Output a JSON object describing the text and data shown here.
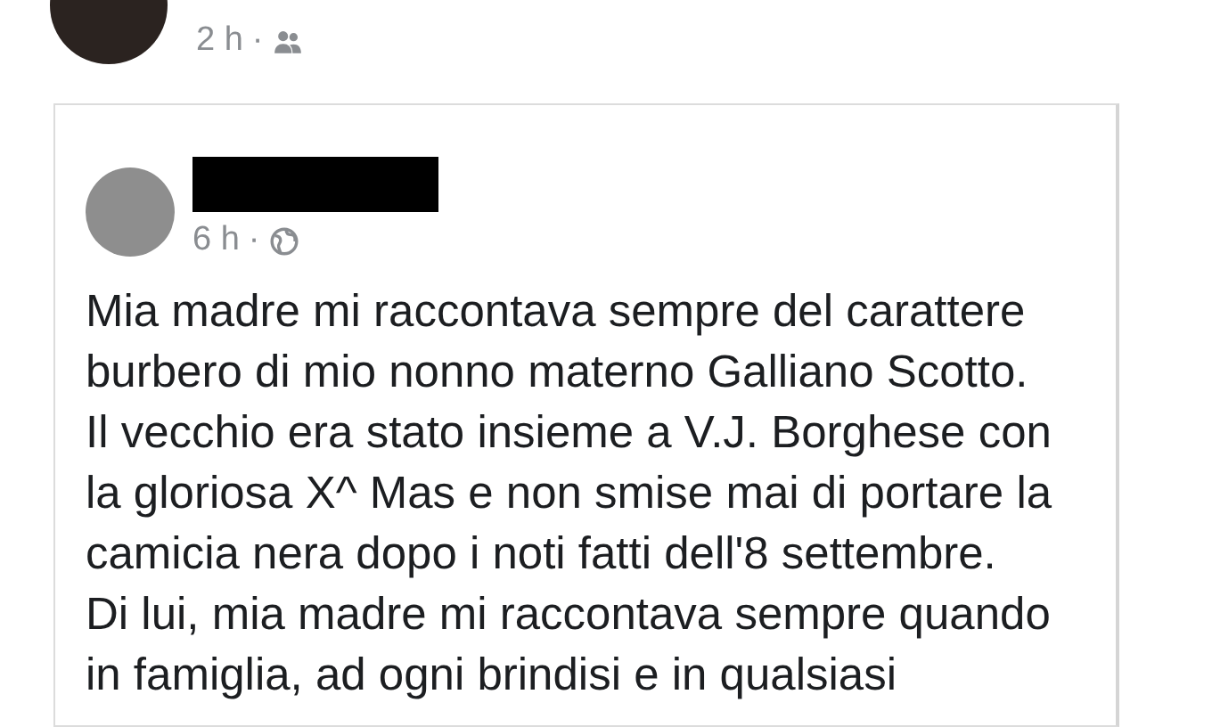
{
  "post": {
    "time": "2 h",
    "separator": "·",
    "kind": "friends"
  },
  "shared_post": {
    "author_redacted": true,
    "time": "6 h",
    "separator": "·",
    "kind": "public",
    "text_lines": [
      "Mia madre mi raccontava sempre del carattere",
      "burbero di mio nonno materno Galliano Scotto.",
      "Il vecchio era stato insieme a V.J. Borghese con",
      "la gloriosa X^ Mas e non smise mai di portare la",
      "camicia nera dopo i noti fatti dell'8 settembre.",
      "Di lui, mia madre mi raccontava sempre quando",
      "in famiglia, ad ogni brindisi e in qualsiasi"
    ]
  }
}
